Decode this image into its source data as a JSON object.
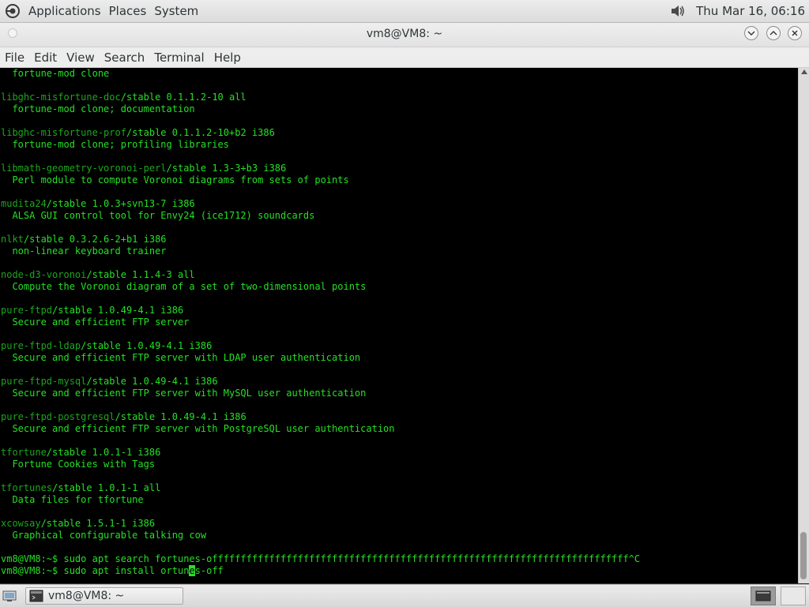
{
  "top_panel": {
    "menus": [
      "Applications",
      "Places",
      "System"
    ],
    "clock": "Thu Mar 16, 06:16",
    "icons": {
      "logo": "gnome-foot-icon",
      "volume": "volume-icon"
    }
  },
  "window": {
    "title": "vm8@VM8: ~",
    "controls": [
      "minimize",
      "maximize",
      "close"
    ]
  },
  "menubar": [
    "File",
    "Edit",
    "View",
    "Search",
    "Terminal",
    "Help"
  ],
  "terminal": {
    "foreground": "#25e025",
    "package_color": "#1ea51e",
    "background": "#000000",
    "lines": [
      {
        "pkg": "",
        "text": "  fortune-mod clone"
      },
      {
        "pkg": "",
        "text": ""
      },
      {
        "pkg": "libghc-misfortune-doc",
        "text": "/stable 0.1.1.2-10 all"
      },
      {
        "pkg": "",
        "text": "  fortune-mod clone; documentation"
      },
      {
        "pkg": "",
        "text": ""
      },
      {
        "pkg": "libghc-misfortune-prof",
        "text": "/stable 0.1.1.2-10+b2 i386"
      },
      {
        "pkg": "",
        "text": "  fortune-mod clone; profiling libraries"
      },
      {
        "pkg": "",
        "text": ""
      },
      {
        "pkg": "libmath-geometry-voronoi-perl",
        "text": "/stable 1.3-3+b3 i386"
      },
      {
        "pkg": "",
        "text": "  Perl module to compute Voronoi diagrams from sets of points"
      },
      {
        "pkg": "",
        "text": ""
      },
      {
        "pkg": "mudita24",
        "text": "/stable 1.0.3+svn13-7 i386"
      },
      {
        "pkg": "",
        "text": "  ALSA GUI control tool for Envy24 (ice1712) soundcards"
      },
      {
        "pkg": "",
        "text": ""
      },
      {
        "pkg": "nlkt",
        "text": "/stable 0.3.2.6-2+b1 i386"
      },
      {
        "pkg": "",
        "text": "  non-linear keyboard trainer"
      },
      {
        "pkg": "",
        "text": ""
      },
      {
        "pkg": "node-d3-voronoi",
        "text": "/stable 1.1.4-3 all"
      },
      {
        "pkg": "",
        "text": "  Compute the Voronoi diagram of a set of two-dimensional points"
      },
      {
        "pkg": "",
        "text": ""
      },
      {
        "pkg": "pure-ftpd",
        "text": "/stable 1.0.49-4.1 i386"
      },
      {
        "pkg": "",
        "text": "  Secure and efficient FTP server"
      },
      {
        "pkg": "",
        "text": ""
      },
      {
        "pkg": "pure-ftpd-ldap",
        "text": "/stable 1.0.49-4.1 i386"
      },
      {
        "pkg": "",
        "text": "  Secure and efficient FTP server with LDAP user authentication"
      },
      {
        "pkg": "",
        "text": ""
      },
      {
        "pkg": "pure-ftpd-mysql",
        "text": "/stable 1.0.49-4.1 i386"
      },
      {
        "pkg": "",
        "text": "  Secure and efficient FTP server with MySQL user authentication"
      },
      {
        "pkg": "",
        "text": ""
      },
      {
        "pkg": "pure-ftpd-postgresql",
        "text": "/stable 1.0.49-4.1 i386"
      },
      {
        "pkg": "",
        "text": "  Secure and efficient FTP server with PostgreSQL user authentication"
      },
      {
        "pkg": "",
        "text": ""
      },
      {
        "pkg": "tfortune",
        "text": "/stable 1.0.1-1 i386"
      },
      {
        "pkg": "",
        "text": "  Fortune Cookies with Tags"
      },
      {
        "pkg": "",
        "text": ""
      },
      {
        "pkg": "tfortunes",
        "text": "/stable 1.0.1-1 all"
      },
      {
        "pkg": "",
        "text": "  Data files for tfortune"
      },
      {
        "pkg": "",
        "text": ""
      },
      {
        "pkg": "xcowsay",
        "text": "/stable 1.5.1-1 i386"
      },
      {
        "pkg": "",
        "text": "  Graphical configurable talking cow"
      },
      {
        "pkg": "",
        "text": ""
      },
      {
        "pkg": "",
        "text": "vm8@VM8:~$ sudo apt search fortunes-offfffffffffffffffffffffffffffffffffffffffffffffffffffffffffffffffffffffff^C"
      }
    ],
    "prompt_line": {
      "before_cursor": "vm8@VM8:~$ sudo apt install ortun",
      "cursor_char": "e",
      "after_cursor": "s-off"
    }
  },
  "scrollbar": {
    "position": "bottom"
  },
  "bottom_panel": {
    "task_label": "vm8@VM8: ~",
    "icons": {
      "show_desktop": "show-desktop-icon",
      "task": "terminal-icon",
      "workspace": "workspace-switcher-icon"
    }
  }
}
